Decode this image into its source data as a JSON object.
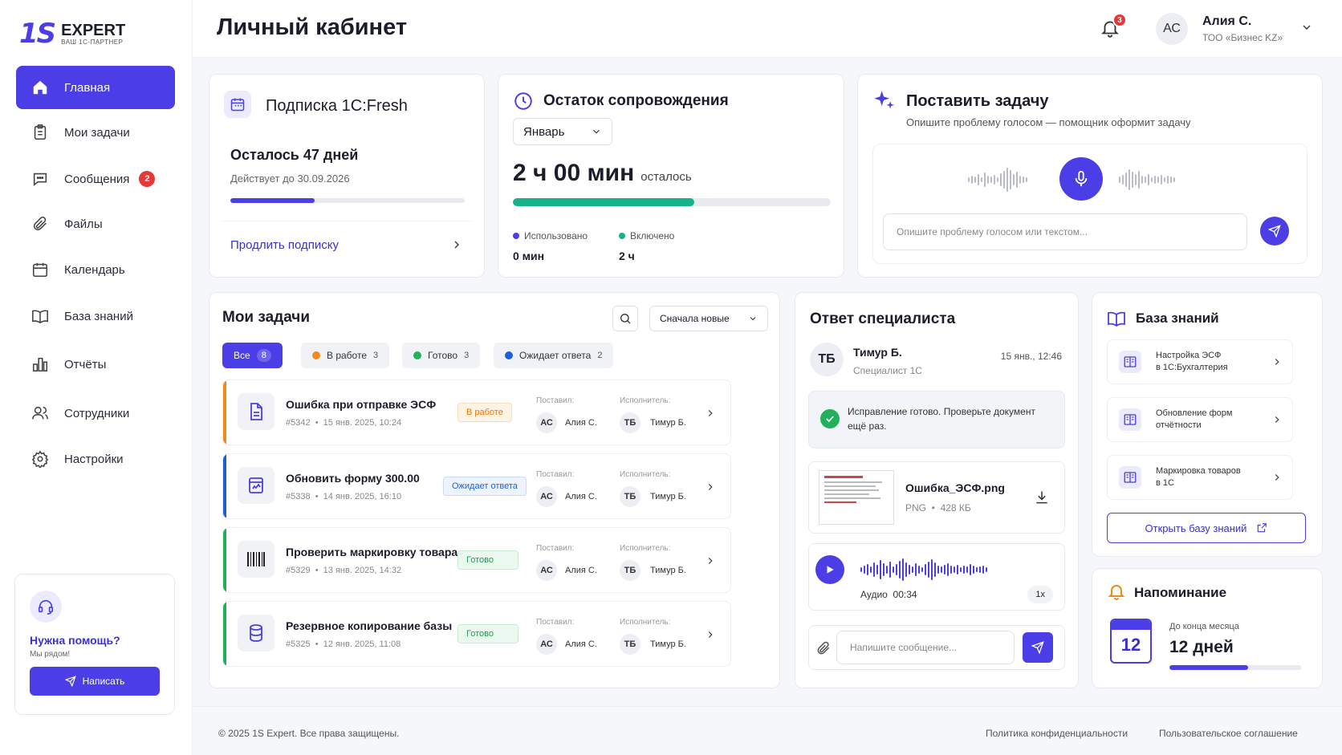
{
  "brand": {
    "mark": "1S",
    "name": "EXPERT",
    "tagline": "ВАШ 1С-ПАРТНЕР"
  },
  "colors": {
    "accent": "#4b3ee6",
    "danger": "#e53935",
    "teal": "#16b38a",
    "orange": "#f08a1c",
    "green": "#22b15a",
    "blue": "#1f5fd6"
  },
  "sidebar": {
    "items": [
      {
        "label": "Главная",
        "icon": "home-icon"
      },
      {
        "label": "Мои задачи",
        "icon": "clipboard-icon"
      },
      {
        "label": "Сообщения",
        "icon": "chat-icon",
        "badge": "2"
      },
      {
        "label": "Файлы",
        "icon": "paperclip-icon"
      },
      {
        "label": "Календарь",
        "icon": "calendar-icon"
      },
      {
        "label": "База знаний",
        "icon": "book-icon"
      },
      {
        "label": "Отчёты",
        "icon": "chart-icon"
      },
      {
        "label": "Сотрудники",
        "icon": "users-icon"
      },
      {
        "label": "Настройки",
        "icon": "gear-icon"
      }
    ],
    "help": {
      "title": "Нужна помощь?",
      "subtitle": "Мы рядом!",
      "button": "Написать"
    }
  },
  "header": {
    "title": "Личный кабинет",
    "notifications": "3",
    "user": {
      "initials": "АС",
      "name": "Алия С.",
      "company": "ТОО «Бизнес KZ»"
    }
  },
  "subscription": {
    "title": "Подписка 1С:Fresh",
    "remaining": "Осталось 47 дней",
    "valid_until": "Действует до 30.09.2026",
    "progress": 0.36,
    "link": "Продлить подписку"
  },
  "support": {
    "title": "Остаток сопровождения",
    "month": "Январь",
    "value": "2 ч 00 мин",
    "value_suffix": "осталось",
    "progress": 0.57,
    "used_label": "Использовано",
    "used_value": "0 мин",
    "included_label": "Включено",
    "included_value": "2 ч"
  },
  "new_task": {
    "title": "Поставить задачу",
    "subtitle": "Опишите проблему голосом — помощник оформит задачу",
    "placeholder": "Опишите проблему голосом или текстом..."
  },
  "tasks": {
    "title": "Мои задачи",
    "sort": "Сначала новые",
    "filters": [
      {
        "label": "Все",
        "count": "8"
      },
      {
        "label": "В работе",
        "count": "3"
      },
      {
        "label": "Готово",
        "count": "3"
      },
      {
        "label": "Ожидает ответа",
        "count": "2"
      }
    ],
    "author_label": "Поставил:",
    "assignee_label": "Исполнитель:",
    "items": [
      {
        "title": "Ошибка при отправке ЭСФ",
        "id": "#5342",
        "date": "15 янв. 2025, 10:24",
        "status": "В работе",
        "author_initials": "АС",
        "author": "Алия С.",
        "assignee_initials": "ТБ",
        "assignee": "Тимур Б.",
        "icon": "document-icon"
      },
      {
        "title": "Обновить форму 300.00",
        "id": "#5338",
        "date": "14 янв. 2025, 16:10",
        "status": "Ожидает ответа",
        "author_initials": "АС",
        "author": "Алия С.",
        "assignee_initials": "ТБ",
        "assignee": "Тимур Б.",
        "icon": "form-icon"
      },
      {
        "title": "Проверить маркировку товара",
        "id": "#5329",
        "date": "13 янв. 2025, 14:32",
        "status": "Готово",
        "author_initials": "АС",
        "author": "Алия С.",
        "assignee_initials": "ТБ",
        "assignee": "Тимур Б.",
        "icon": "barcode-icon"
      },
      {
        "title": "Резервное копирование базы",
        "id": "#5325",
        "date": "12 янв. 2025, 11:08",
        "status": "Готово",
        "author_initials": "АС",
        "author": "Алия С.",
        "assignee_initials": "ТБ",
        "assignee": "Тимур Б.",
        "icon": "database-icon"
      }
    ]
  },
  "specialist": {
    "title": "Ответ специалиста",
    "initials": "ТБ",
    "name": "Тимур Б.",
    "role": "Специалист 1С",
    "time": "15 янв., 12:46",
    "message": "Исправление готово. Проверьте документ ещё раз.",
    "file": {
      "name": "Ошибка_ЭСФ.png",
      "type": "PNG",
      "size": "428 КБ"
    },
    "audio": {
      "label": "Аудио",
      "duration": "00:34",
      "speed": "1x"
    },
    "placeholder": "Напишите сообщение..."
  },
  "knowledge": {
    "title": "База знаний",
    "items": [
      {
        "line1": "Настройка ЭСФ",
        "line2": "в 1С:Бухгалтерия"
      },
      {
        "line1": "Обновление форм",
        "line2": "отчётности"
      },
      {
        "line1": "Маркировка товаров",
        "line2": "в 1С"
      }
    ],
    "button": "Открыть базу знаний"
  },
  "reminder": {
    "title": "Напоминание",
    "day": "12",
    "label": "До конца месяца",
    "value": "12 дней",
    "progress": 0.6
  },
  "footer": {
    "copyright": "© 2025 1S Expert. Все права защищены.",
    "privacy": "Политика конфиденциальности",
    "terms": "Пользовательское соглашение"
  }
}
